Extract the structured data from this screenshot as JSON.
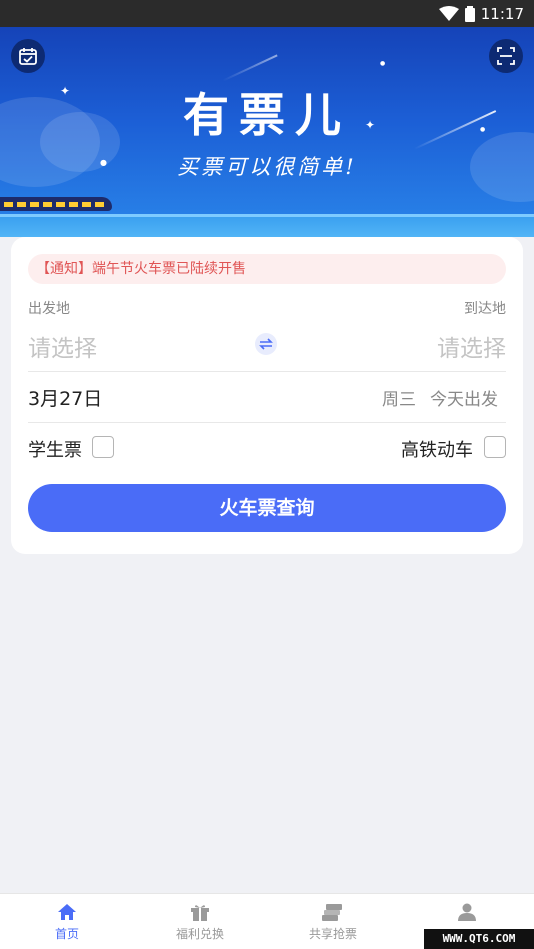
{
  "status_bar": {
    "time": "11:17"
  },
  "hero": {
    "app_name": "有票儿",
    "slogan": "买票可以很简单!"
  },
  "notice": {
    "text": "【通知】端午节火车票已陆续开售"
  },
  "route": {
    "from_label": "出发地",
    "to_label": "到达地",
    "from_placeholder": "请选择",
    "to_placeholder": "请选择"
  },
  "date": {
    "value": "3月27日",
    "weekday": "周三",
    "note": "今天出发"
  },
  "options": {
    "student_label": "学生票",
    "highspeed_label": "高铁动车"
  },
  "search_button": "火车票查询",
  "tabs": [
    {
      "label": "首页",
      "icon": "home-icon"
    },
    {
      "label": "福利兑换",
      "icon": "gift-icon"
    },
    {
      "label": "共享抢票",
      "icon": "tickets-icon"
    },
    {
      "label": "",
      "icon": "user-icon"
    }
  ],
  "watermark": "WWW.QT6.COM",
  "colors": {
    "accent": "#4a6cf7",
    "hero_top": "#1543b8",
    "notice_text": "#e05555"
  }
}
